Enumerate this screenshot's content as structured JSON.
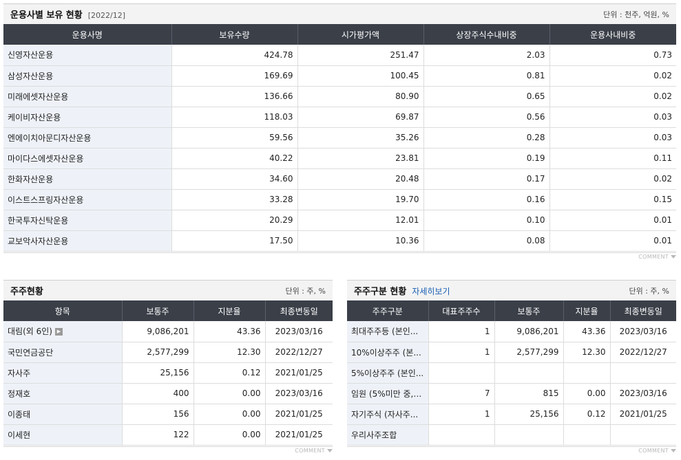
{
  "fund_section": {
    "title": "운용사별 보유 현황",
    "date": "[2022/12]",
    "unit": "단위 : 천주, 억원, %",
    "headers": [
      "운용사명",
      "보유수량",
      "시가평가액",
      "상장주식수내비중",
      "운용사내비중"
    ],
    "rows": [
      [
        "신영자산운용",
        "424.78",
        "251.47",
        "2.03",
        "0.73"
      ],
      [
        "삼성자산운용",
        "169.69",
        "100.45",
        "0.81",
        "0.02"
      ],
      [
        "미래에셋자산운용",
        "136.66",
        "80.90",
        "0.65",
        "0.02"
      ],
      [
        "케이비자산운용",
        "118.03",
        "69.87",
        "0.56",
        "0.03"
      ],
      [
        "엔에이치아문디자산운용",
        "59.56",
        "35.26",
        "0.28",
        "0.03"
      ],
      [
        "마이다스에셋자산운용",
        "40.22",
        "23.81",
        "0.19",
        "0.11"
      ],
      [
        "한화자산운용",
        "34.60",
        "20.48",
        "0.17",
        "0.02"
      ],
      [
        "이스트스프링자산운용",
        "33.28",
        "19.70",
        "0.16",
        "0.15"
      ],
      [
        "한국투자신탁운용",
        "20.29",
        "12.01",
        "0.10",
        "0.01"
      ],
      [
        "교보악사자산운용",
        "17.50",
        "10.36",
        "0.08",
        "0.01"
      ]
    ],
    "comment": "COMMENT"
  },
  "holder_section": {
    "title": "주주현황",
    "unit": "단위 : 주, %",
    "headers": [
      "항목",
      "보통주",
      "지분율",
      "최종변동일"
    ],
    "rows": [
      [
        "대림(외 6인)",
        "9,086,201",
        "43.36",
        "2023/03/16"
      ],
      [
        "국민연금공단",
        "2,577,299",
        "12.30",
        "2022/12/27"
      ],
      [
        "자사주",
        "25,156",
        "0.12",
        "2021/01/25"
      ],
      [
        "정재호",
        "400",
        "0.00",
        "2023/03/16"
      ],
      [
        "이종태",
        "156",
        "0.00",
        "2021/01/25"
      ],
      [
        "이세현",
        "122",
        "0.00",
        "2021/01/25"
      ]
    ],
    "more_icon": "play-icon",
    "comment": "COMMENT"
  },
  "category_section": {
    "title": "주주구분 현황",
    "link": "자세히보기",
    "unit": "단위 : 주, %",
    "headers": [
      "주주구분",
      "대표주주수",
      "보통주",
      "지분율",
      "최종변동일"
    ],
    "rows": [
      [
        "최대주주등 (본인...",
        "1",
        "9,086,201",
        "43.36",
        "2023/03/16"
      ],
      [
        "10%이상주주 (본...",
        "1",
        "2,577,299",
        "12.30",
        "2022/12/27"
      ],
      [
        "5%이상주주 (본인...",
        "",
        "",
        "",
        ""
      ],
      [
        "임원 (5%미만 중, ...",
        "7",
        "815",
        "0.00",
        "2023/03/16"
      ],
      [
        "자기주식 (자사주...",
        "1",
        "25,156",
        "0.12",
        "2021/01/25"
      ],
      [
        "우리사주조합",
        "",
        "",
        "",
        ""
      ]
    ],
    "comment": "COMMENT"
  }
}
